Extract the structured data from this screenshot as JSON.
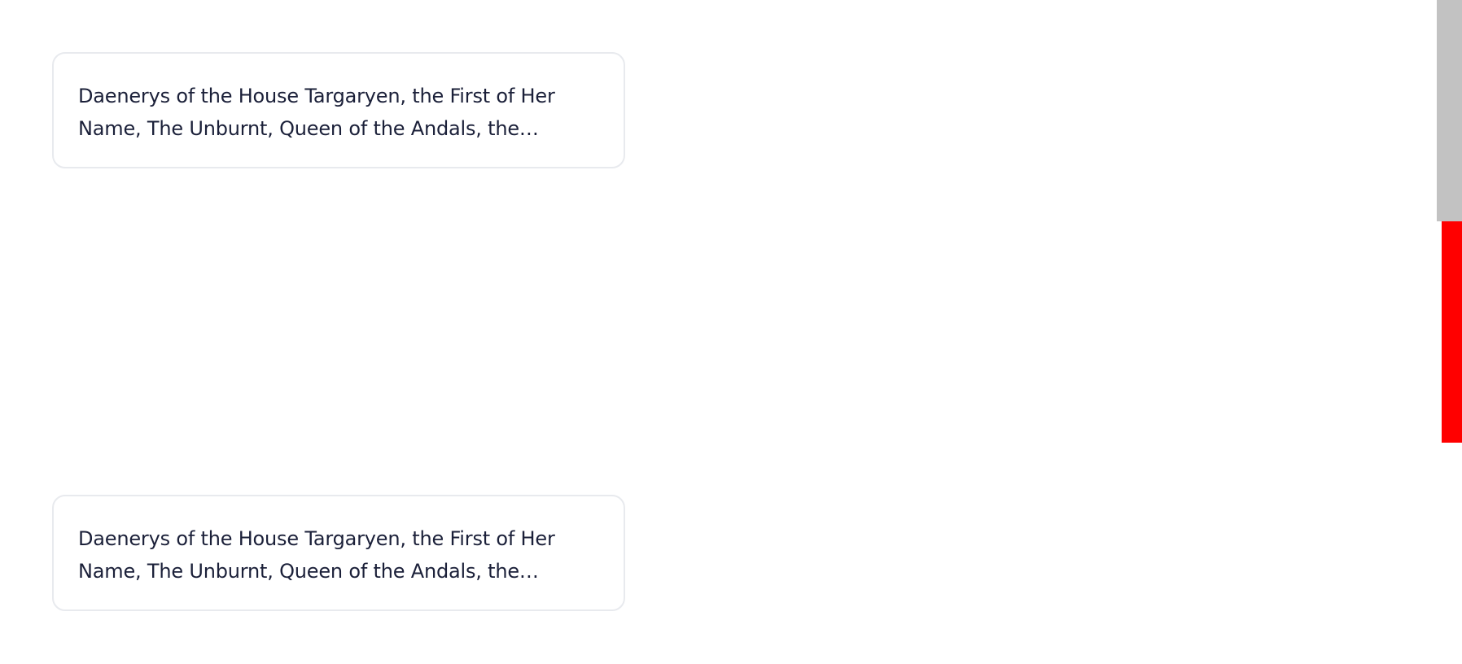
{
  "cards": [
    {
      "text": "Daenerys of the House Targaryen, the First of Her Name, The Unburnt, Queen of the Andals, the…"
    },
    {
      "text": "Daenerys of the House Targaryen, the First of Her Name, The Unburnt, Queen of the Andals, the…"
    }
  ],
  "colors": {
    "text": "#1b2039",
    "card_border": "#e8eaee",
    "scrollbar": "#c2c2c2",
    "scroll_marker": "#ff0000"
  }
}
